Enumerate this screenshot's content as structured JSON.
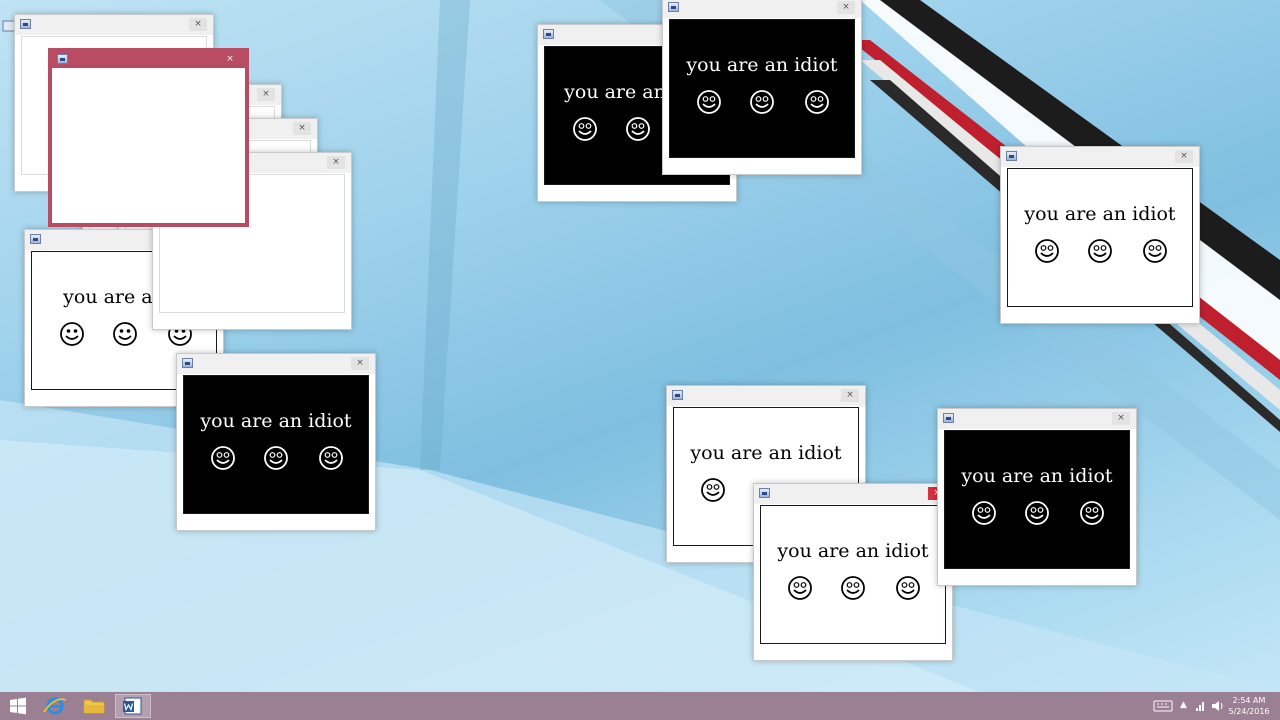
{
  "window_message": "you are an idiot",
  "truncated_message": "you are an",
  "close_glyph": "×",
  "colors": {
    "active_frame": "#b84c62",
    "taskbar": "#9b7f93",
    "stripe_red": "#c0202e"
  },
  "icons": {
    "app": "document-app-icon",
    "smiley": "smiley-face-icon",
    "start": "windows-start-icon",
    "ie": "internet-explorer-icon",
    "explorer": "file-explorer-icon",
    "word": "word-icon"
  },
  "taskbar": {
    "tray": {
      "keyboard": "keyboard-icon",
      "chevron": "▲",
      "network": "network-icon",
      "volume": "volume-icon"
    },
    "clock": {
      "time": "2:54 AM",
      "date": "5/24/2016"
    }
  }
}
